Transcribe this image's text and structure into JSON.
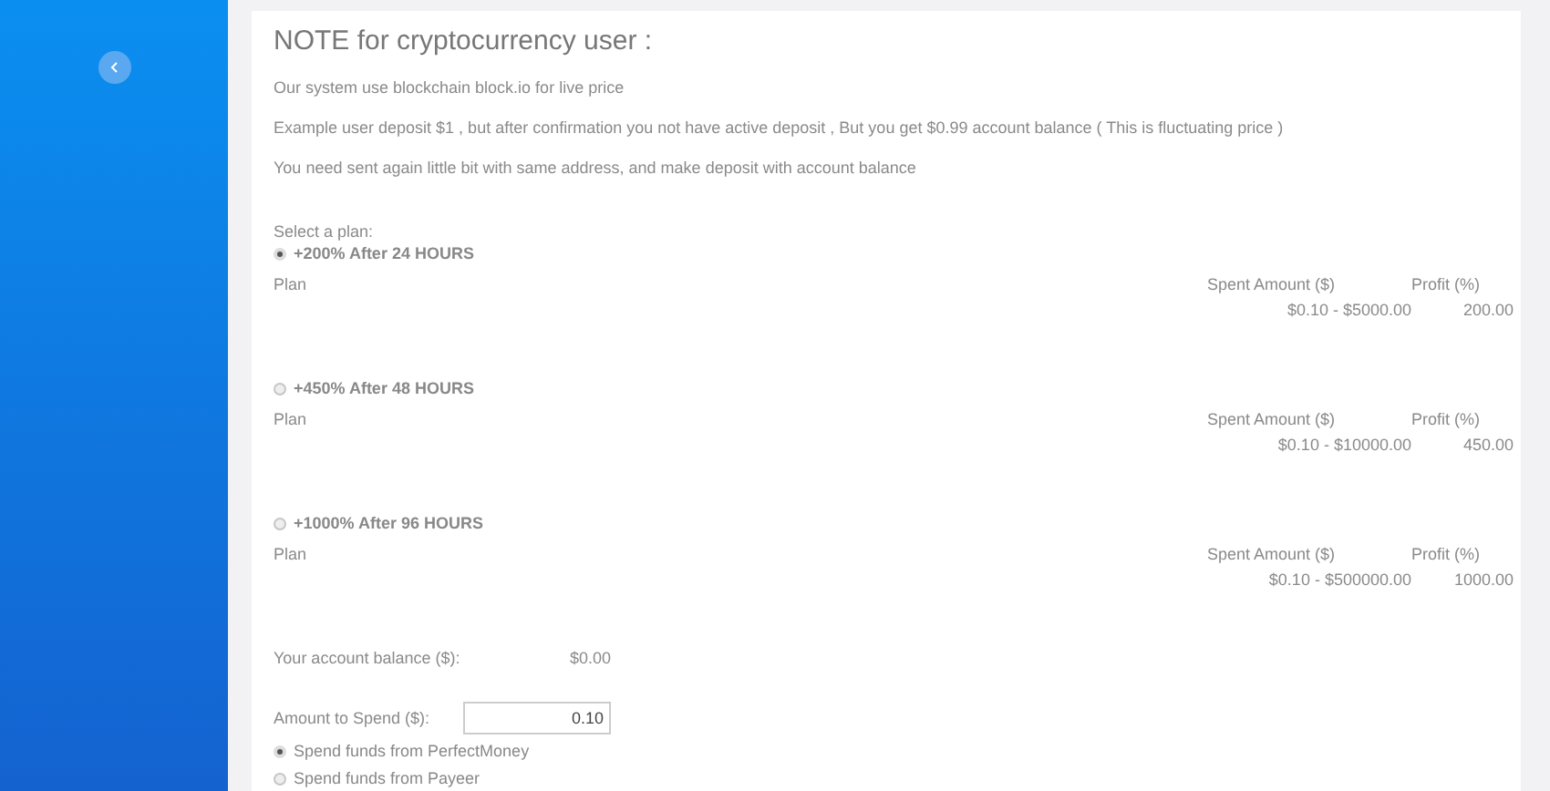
{
  "note": {
    "title": "NOTE for cryptocurrency user :",
    "paragraphs": [
      "Our system use blockchain block.io for live price",
      "Example user deposit $1 , but after confirmation you not have active deposit , But you get $0.99 account balance ( This is fluctuating price )",
      "You need sent again little bit with same address, and make deposit with account balance"
    ]
  },
  "plan_prompt": "Select a plan:",
  "plans": [
    {
      "name": "+200% After 24 HOURS",
      "selected": true,
      "plan_label": "Plan",
      "amount_header": "Spent Amount ($)",
      "profit_header": "Profit (%)",
      "amount_range": "$0.10 - $5000.00",
      "profit": "200.00"
    },
    {
      "name": "+450% After 48 HOURS",
      "selected": false,
      "plan_label": "Plan",
      "amount_header": "Spent Amount ($)",
      "profit_header": "Profit (%)",
      "amount_range": "$0.10 - $10000.00",
      "profit": "450.00"
    },
    {
      "name": "+1000% After 96 HOURS",
      "selected": false,
      "plan_label": "Plan",
      "amount_header": "Spent Amount ($)",
      "profit_header": "Profit (%)",
      "amount_range": "$0.10 - $500000.00",
      "profit": "1000.00"
    }
  ],
  "balance": {
    "label": "Your account balance ($):",
    "value": "$0.00"
  },
  "amount": {
    "label": "Amount to Spend ($):",
    "value": "0.10"
  },
  "payment_options": [
    {
      "label": "Spend funds from PerfectMoney",
      "selected": true
    },
    {
      "label": "Spend funds from Payeer",
      "selected": false
    }
  ]
}
